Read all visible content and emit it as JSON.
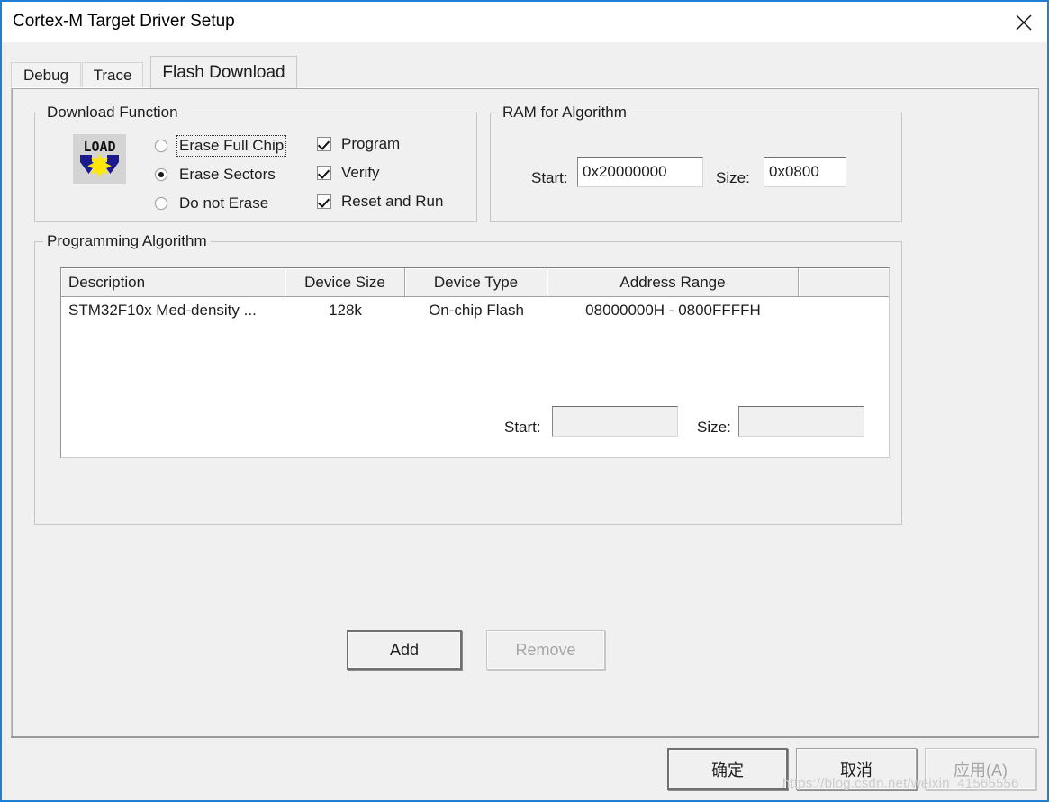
{
  "window": {
    "title": "Cortex-M Target Driver Setup",
    "close_icon": "close-icon"
  },
  "tabs": [
    {
      "label": "Debug",
      "active": false
    },
    {
      "label": "Trace",
      "active": false
    },
    {
      "label": "Flash Download",
      "active": true
    }
  ],
  "download_function": {
    "legend": "Download Function",
    "icon": "load-icon",
    "erase_mode_selected": "Erase Sectors",
    "radios": [
      {
        "label": "Erase Full Chip",
        "selected": false,
        "focused": true
      },
      {
        "label": "Erase Sectors",
        "selected": true,
        "focused": false
      },
      {
        "label": "Do not Erase",
        "selected": false,
        "focused": false
      }
    ],
    "checkboxes": [
      {
        "label": "Program",
        "checked": true
      },
      {
        "label": "Verify",
        "checked": true
      },
      {
        "label": "Reset and Run",
        "checked": true
      }
    ]
  },
  "ram_for_algorithm": {
    "legend": "RAM for Algorithm",
    "start_label": "Start:",
    "start_value": "0x20000000",
    "size_label": "Size:",
    "size_value": "0x0800"
  },
  "programming_algorithm": {
    "legend": "Programming Algorithm",
    "columns": [
      "Description",
      "Device Size",
      "Device Type",
      "Address Range",
      ""
    ],
    "rows": [
      {
        "description": "STM32F10x Med-density ...",
        "device_size": "128k",
        "device_type": "On-chip Flash",
        "address_range": "08000000H - 0800FFFFH",
        "extra": ""
      }
    ],
    "start_label": "Start:",
    "start_value": "",
    "size_label": "Size:",
    "size_value": ""
  },
  "algorithm_buttons": {
    "add_label": "Add",
    "remove_label": "Remove",
    "remove_disabled": true
  },
  "dialog_buttons": {
    "ok_label": "确定",
    "cancel_label": "取消",
    "apply_label": "应用(A)",
    "apply_disabled": true
  },
  "watermark": "https://blog.csdn.net/weixin_41565556",
  "colors": {
    "window_border": "#1e7fd4",
    "dialog_bg": "#f0f0f0",
    "titlebar_bg": "#ffffff",
    "text": "#1c1c1c",
    "field_bg": "#ffffff",
    "disabled_text": "#a6a6a6",
    "icon_blue": "#1b1b8f",
    "icon_yellow": "#ffe808"
  }
}
